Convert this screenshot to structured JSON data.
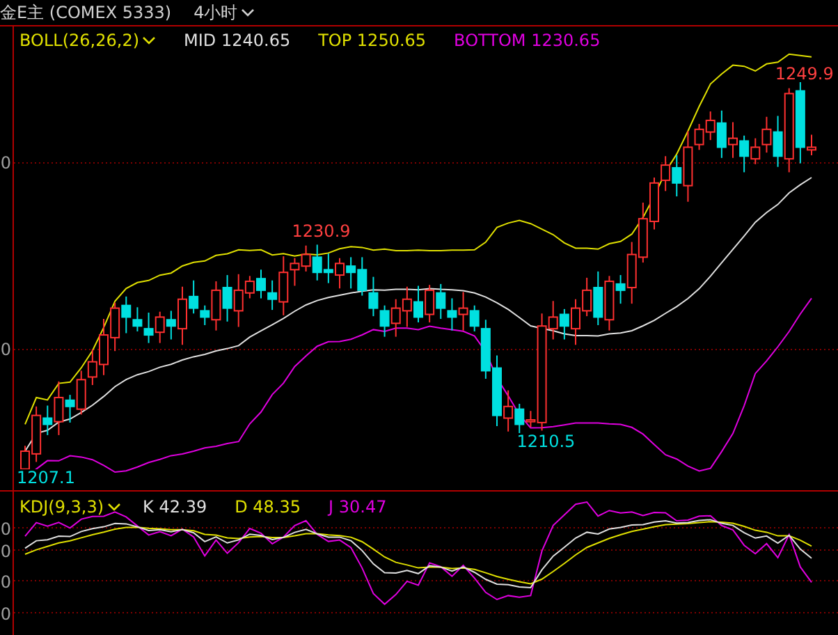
{
  "title": "金E主 (COMEX 5333)",
  "period": {
    "label": "4小时"
  },
  "main_panel": {
    "indicator": "BOLL(26,26,2)",
    "readings": [
      {
        "label": "MID 1240.65",
        "color": "#e0e0e0"
      },
      {
        "label": "TOP 1250.65",
        "color": "#e0e000"
      },
      {
        "label": "BOTTOM 1230.65",
        "color": "#e000e0"
      }
    ],
    "axis_labels": [
      "0",
      "0"
    ],
    "price_labels": [
      {
        "text": "1230.9",
        "kind": "high"
      },
      {
        "text": "1249.9",
        "kind": "high"
      },
      {
        "text": "1210.5",
        "kind": "low"
      },
      {
        "text": "1207.1",
        "kind": "low"
      }
    ]
  },
  "kdj_panel": {
    "indicator": "KDJ(9,3,3)",
    "readings": [
      {
        "label": "K 42.39",
        "color": "#e0e0e0"
      },
      {
        "label": "D 48.35",
        "color": "#e0e000"
      },
      {
        "label": "J 30.47",
        "color": "#e000e0"
      }
    ],
    "axis_labels": [
      "0",
      "0",
      "0",
      "0"
    ]
  }
}
